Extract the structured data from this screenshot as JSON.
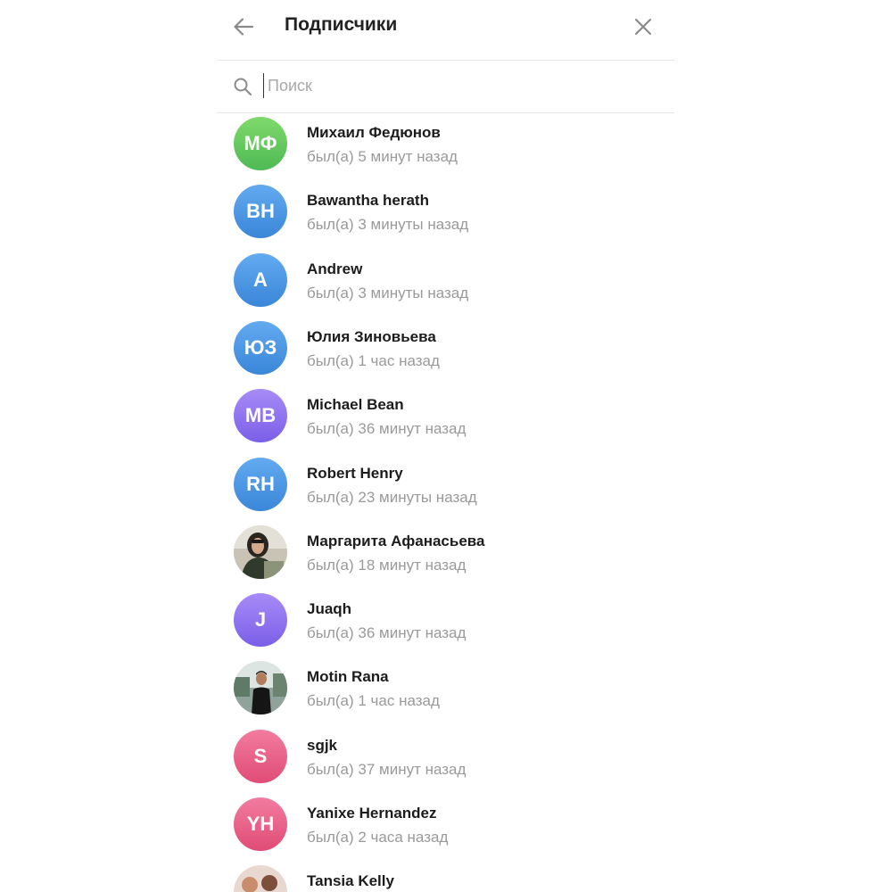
{
  "header": {
    "title": "Подписчики",
    "back_icon": "arrow-left-icon",
    "close_icon": "close-icon"
  },
  "search": {
    "placeholder": "Поиск",
    "value": "",
    "icon": "search-icon"
  },
  "colors": {
    "green": "#5cc85a",
    "blue": "#3f95e0",
    "purple": "#8a6ef0",
    "pink": "#e85a80",
    "status_text": "#9a9a9a"
  },
  "subscribers": [
    {
      "name": "Михаил Федюнов",
      "status": "был(а) 5 минут назад",
      "initials": "МФ",
      "avatar": "green"
    },
    {
      "name": "Bawantha herath",
      "status": "был(а) 3 минуты назад",
      "initials": "BH",
      "avatar": "blue"
    },
    {
      "name": "Andrew",
      "status": "был(а) 3 минуты назад",
      "initials": "A",
      "avatar": "blue"
    },
    {
      "name": "Юлия Зиновьева",
      "status": "был(а) 1 час назад",
      "initials": "ЮЗ",
      "avatar": "blue"
    },
    {
      "name": "Michael Bean",
      "status": "был(а) 36 минут назад",
      "initials": "MB",
      "avatar": "purple"
    },
    {
      "name": "Robert Henry",
      "status": "был(а) 23 минуты назад",
      "initials": "RH",
      "avatar": "blue"
    },
    {
      "name": "Маргарита Афанасьева",
      "status": "был(а) 18 минут назад",
      "initials": "",
      "avatar": "photo-woman"
    },
    {
      "name": "Juaqh",
      "status": "был(а) 36 минут назад",
      "initials": "J",
      "avatar": "purple"
    },
    {
      "name": "Motin Rana",
      "status": "был(а) 1 час назад",
      "initials": "",
      "avatar": "photo-man"
    },
    {
      "name": "sgjk",
      "status": "был(а) 37 минут назад",
      "initials": "S",
      "avatar": "pink"
    },
    {
      "name": "Yanixe Hernandez",
      "status": "был(а) 2 часа назад",
      "initials": "YH",
      "avatar": "pink"
    },
    {
      "name": "Tansia Kelly",
      "status": "",
      "initials": "",
      "avatar": "photo-group"
    }
  ]
}
